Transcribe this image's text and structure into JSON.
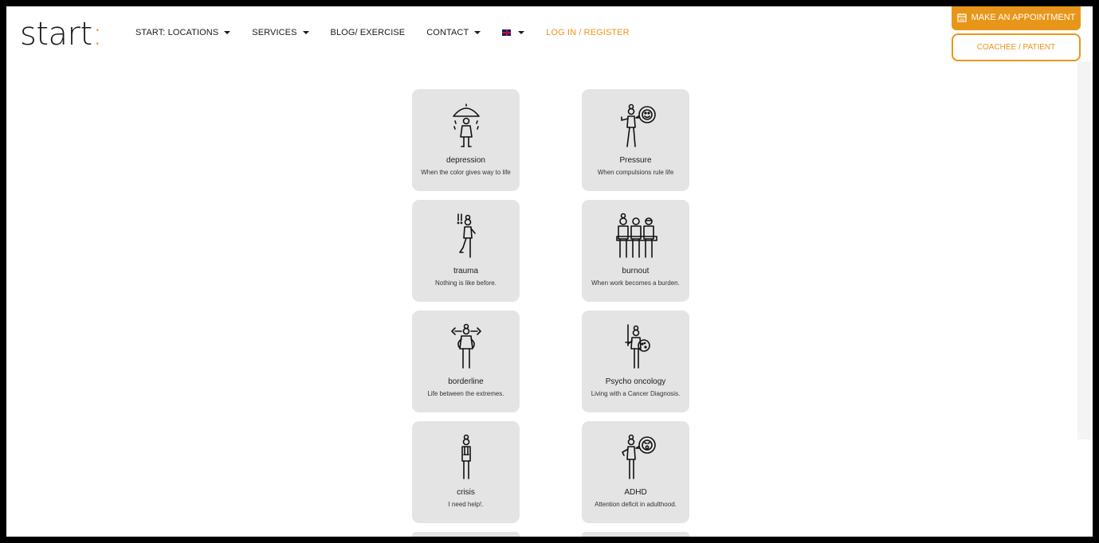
{
  "brand": {
    "name": "start",
    "accent": "#e8961a"
  },
  "nav": {
    "items": [
      {
        "label": "START: LOCATIONS",
        "dropdown": true
      },
      {
        "label": "SERVICES",
        "dropdown": true
      },
      {
        "label": "BLOG/ EXERCISE",
        "dropdown": false
      },
      {
        "label": "CONTACT",
        "dropdown": true
      }
    ],
    "language_flag": "uk-flag-icon",
    "login_label": "LOG IN / REGISTER"
  },
  "cta": {
    "appointment_label": "MAKE AN APPOINTMENT",
    "patient_label": "COACHEE / PATIENT"
  },
  "topics": [
    {
      "title": "depression",
      "subtitle": "When the color gives way to life",
      "icon": "umbrella-person-icon"
    },
    {
      "title": "Pressure",
      "subtitle": "When compulsions rule life",
      "icon": "person-speech-bubble-icon"
    },
    {
      "title": "trauma",
      "subtitle": "Nothing is like before.",
      "icon": "startled-person-icon"
    },
    {
      "title": "burnout",
      "subtitle": "When work becomes a burden.",
      "icon": "three-people-icon"
    },
    {
      "title": "borderline",
      "subtitle": "Life between the extremes.",
      "icon": "arrows-person-icon"
    },
    {
      "title": "Psycho oncology",
      "subtitle": "Living with a Cancer Diagnosis.",
      "icon": "sword-shield-person-icon"
    },
    {
      "title": "crisis",
      "subtitle": "I need help!.",
      "icon": "standing-person-icon"
    },
    {
      "title": "ADHD",
      "subtitle": "Attention deficit in adulthood.",
      "icon": "person-shouting-bubble-icon"
    }
  ]
}
